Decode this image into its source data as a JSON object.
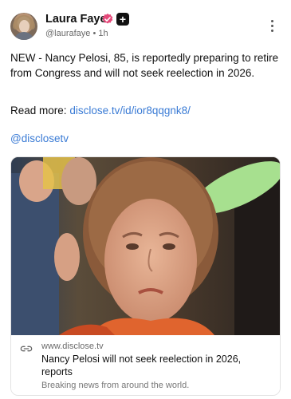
{
  "author": {
    "name": "Laura Faye",
    "handle": "@laurafaye",
    "separator": "•",
    "time": "1h",
    "verified_color": "#e5497a",
    "plus_badge": "+"
  },
  "menu": {
    "icon": "more-vertical-icon"
  },
  "post": {
    "text": "NEW - Nancy Pelosi, 85, is reportedly preparing to retire from Congress and will not seek reelection in 2026.",
    "read_more_label": "Read more:",
    "read_more_link": "disclose.tv/id/ior8qqgnk8/",
    "mention": "@disclosetv",
    "link_color": "#3a7bd5"
  },
  "link_card": {
    "image": "news-photo",
    "domain": "www.disclose.tv",
    "title": "Nancy Pelosi will not seek reelection in 2026, reports",
    "description": "Breaking news from around the world."
  }
}
